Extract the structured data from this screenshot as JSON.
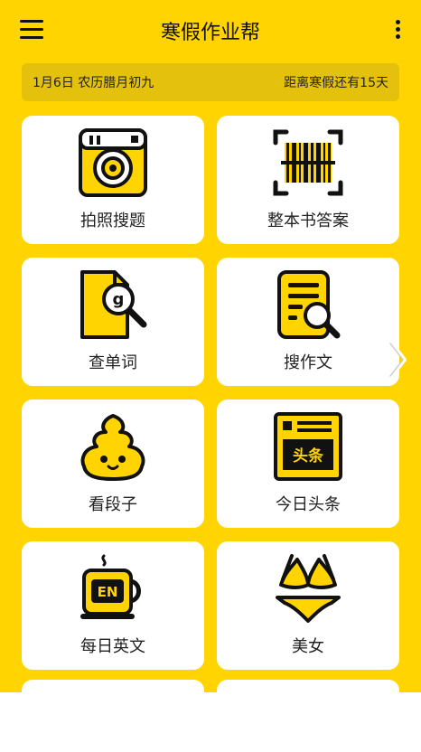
{
  "app": {
    "title": "寒假作业帮"
  },
  "header": {
    "menu_icon": "hamburger-menu-icon",
    "more_icon": "more-vertical-icon"
  },
  "date_bar": {
    "left": "1月6日 农历腊月初九",
    "right": "距离寒假还有15天"
  },
  "tiles": [
    {
      "label": "拍照搜题",
      "icon": "camera-icon"
    },
    {
      "label": "整本书答案",
      "icon": "barcode-scan-icon"
    },
    {
      "label": "查单词",
      "icon": "word-search-icon"
    },
    {
      "label": "搜作文",
      "icon": "document-search-icon"
    },
    {
      "label": "看段子",
      "icon": "poop-emoji-icon"
    },
    {
      "label": "今日头条",
      "icon": "news-headline-icon"
    },
    {
      "label": "每日英文",
      "icon": "english-cup-icon"
    },
    {
      "label": "美女",
      "icon": "bikini-icon"
    }
  ],
  "headline_badge": "头条",
  "cup_text": "EN",
  "search_letter": "g",
  "nav": {
    "next_icon": "chevron-right-icon"
  },
  "colors": {
    "background": "#FFD400",
    "tile": "#FFFFFF",
    "date_bar": "#E4C10C",
    "icon_fill": "#FFD400",
    "ink": "#111111"
  }
}
